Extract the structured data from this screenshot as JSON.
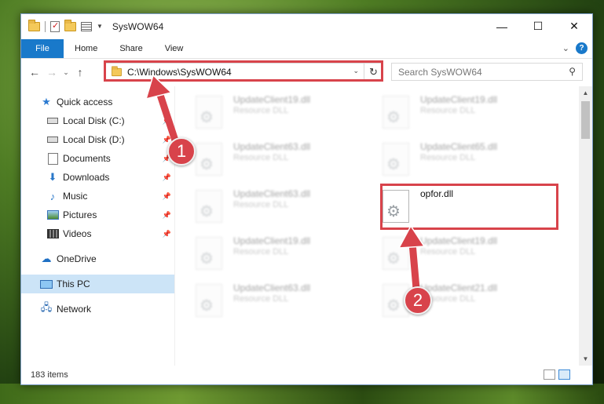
{
  "window": {
    "title": "SysWOW64",
    "controls": {
      "minimize": "—",
      "maximize": "☐",
      "close": "✕"
    }
  },
  "ribbon": {
    "tabs": [
      "File",
      "Home",
      "Share",
      "View"
    ],
    "expand_icon": "chevron-down-icon",
    "help_icon": "?"
  },
  "address_bar": {
    "path": "C:\\Windows\\SysWOW64",
    "refresh_icon": "↻"
  },
  "search": {
    "placeholder": "Search SysWOW64"
  },
  "nav_pane": {
    "quick_access": "Quick access",
    "items": [
      {
        "label": "Local Disk (C:)",
        "pinned": true
      },
      {
        "label": "Local Disk (D:)",
        "pinned": true
      },
      {
        "label": "Documents",
        "pinned": true
      },
      {
        "label": "Downloads",
        "pinned": true
      },
      {
        "label": "Music",
        "pinned": true
      },
      {
        "label": "Pictures",
        "pinned": true
      },
      {
        "label": "Videos",
        "pinned": true
      }
    ],
    "onedrive": "OneDrive",
    "this_pc": "This PC",
    "network": "Network"
  },
  "files": [
    {
      "name": "UpdateClient19.dll",
      "type": "Resource DLL"
    },
    {
      "name": "UpdateClient19.dll",
      "type": "Resource DLL"
    },
    {
      "name": "UpdateClient63.dll",
      "type": "Resource DLL"
    },
    {
      "name": "UpdateClient65.dll",
      "type": "Resource DLL"
    },
    {
      "name": "UpdateClient63.dll",
      "type": "Resource DLL"
    },
    {
      "name": "opfor.dll",
      "type": ""
    },
    {
      "name": "UpdateClient19.dll",
      "type": "Resource DLL"
    },
    {
      "name": "UpdateClient19.dll",
      "type": "Resource DLL"
    },
    {
      "name": "UpdateClient63.dll",
      "type": "Resource DLL"
    },
    {
      "name": "UpdateClient21.dll",
      "type": "Resource DLL"
    }
  ],
  "status": {
    "item_count": "183 items"
  },
  "annotations": {
    "step1": "1",
    "step2": "2",
    "color": "#d8434b"
  }
}
